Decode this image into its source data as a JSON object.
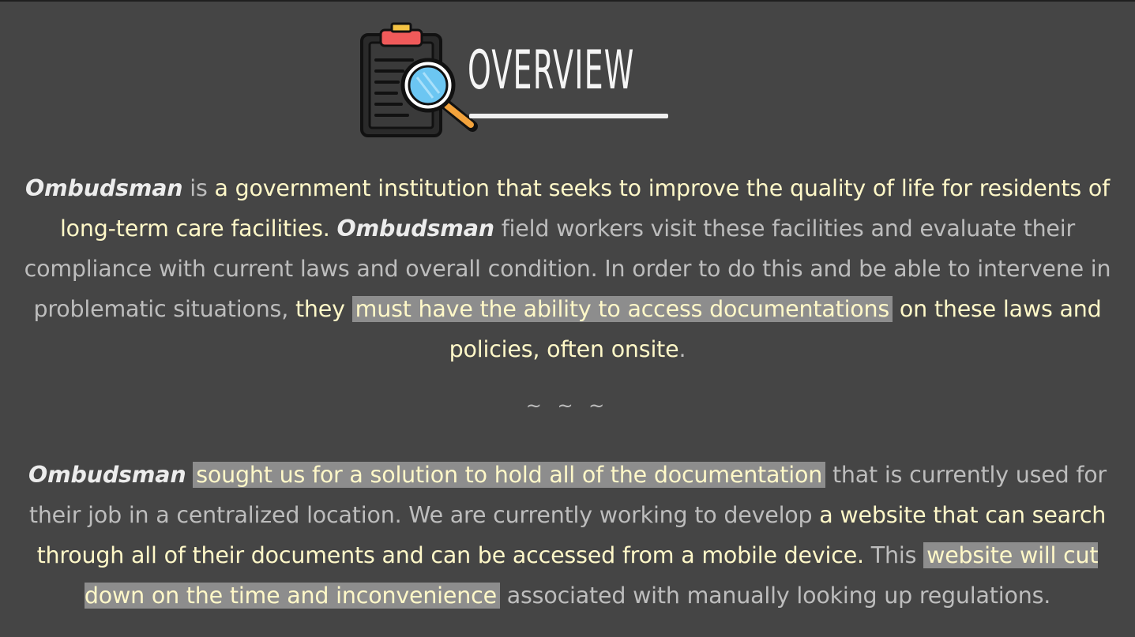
{
  "header": {
    "title": "OVERVIEW",
    "icon": "clipboard-magnifier-icon"
  },
  "paragraph1": {
    "s1": "Ombudsman",
    "s2": " is ",
    "s3": "a government institution that seeks to improve the quality of life for residents of long-term care facilities. ",
    "s4": "Ombudsman",
    "s5": " field workers visit these facilities and evaluate their compliance with current laws and overall condition. In order to do this and be able to intervene in problematic situations, ",
    "s6": "they",
    "s7": "must have the ability to access documentations",
    "s8": "on these laws and policies, often onsite",
    "s9": "."
  },
  "divider": "~ ~ ~",
  "paragraph2": {
    "s1": "Ombudsman",
    "s2": "sought us for a solution to hold all of the documentation",
    "s3": "that is currently used for their job in a centralized location. We are currently working to develop ",
    "s4": "a website that can search through all of their documents and can be accessed from a mobile device.",
    "s5": " This",
    "s6": "website will cut down on the time and inconvenience",
    "s7": "associated with manually looking up regulations."
  },
  "colors": {
    "background": "#454545",
    "body_text": "#bdbdbd",
    "highlight_text": "#fff8c8",
    "highlight_box": "#8d8d8d"
  }
}
